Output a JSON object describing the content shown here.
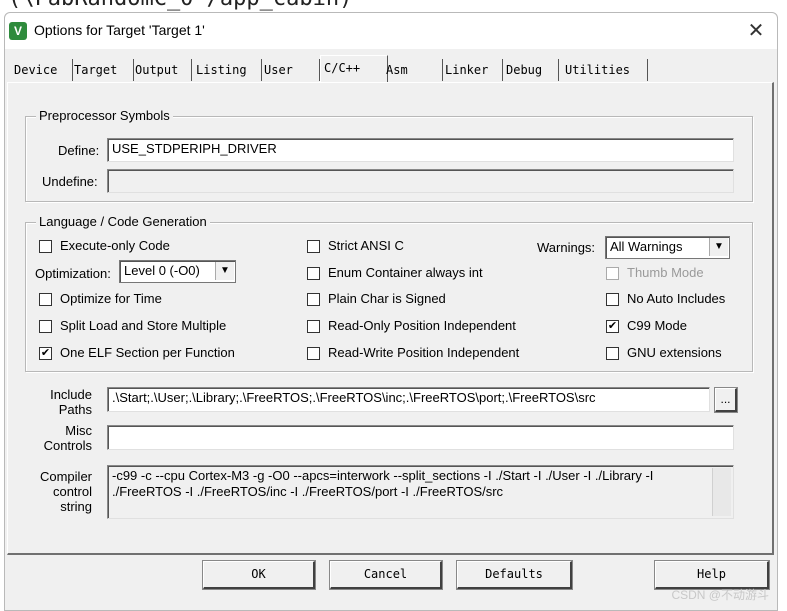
{
  "background_text": "(\\FabRandomC_0'/app_cabin)",
  "window": {
    "title": "Options for Target 'Target 1'",
    "close_glyph": "✕",
    "app_icon_glyph": "V"
  },
  "tabs": [
    {
      "label": "Device"
    },
    {
      "label": "Target"
    },
    {
      "label": "Output"
    },
    {
      "label": "Listing"
    },
    {
      "label": "User"
    },
    {
      "label": "C/C++"
    },
    {
      "label": "Asm"
    },
    {
      "label": "Linker"
    },
    {
      "label": "Debug"
    },
    {
      "label": "Utilities"
    }
  ],
  "active_tab": "C/C++",
  "preprocessor": {
    "group_label": "Preprocessor Symbols",
    "define_label": "Define:",
    "define_value": "USE_STDPERIPH_DRIVER",
    "undefine_label": "Undefine:",
    "undefine_value": ""
  },
  "language": {
    "group_label": "Language / Code Generation",
    "execute_only": {
      "label": "Execute-only Code",
      "checked": false
    },
    "optimization_label": "Optimization:",
    "optimization_value": "Level 0 (-O0)",
    "optimize_for_time": {
      "label": "Optimize for Time",
      "checked": false
    },
    "split_load_store": {
      "label": "Split Load and Store Multiple",
      "checked": false
    },
    "one_elf_section": {
      "label": "One ELF Section per Function",
      "checked": true
    },
    "strict_ansi_c": {
      "label": "Strict ANSI C",
      "checked": false
    },
    "enum_container": {
      "label": "Enum Container always int",
      "checked": false
    },
    "plain_char_signed": {
      "label": "Plain Char is Signed",
      "checked": false
    },
    "ro_pos_indep": {
      "label": "Read-Only Position Independent",
      "checked": false
    },
    "rw_pos_indep": {
      "label": "Read-Write Position Independent",
      "checked": false
    },
    "warnings_label": "Warnings:",
    "warnings_value": "All Warnings",
    "thumb_mode": {
      "label": "Thumb Mode",
      "checked": false,
      "disabled": true
    },
    "no_auto_includes": {
      "label": "No Auto Includes",
      "checked": false
    },
    "c99_mode": {
      "label": "C99 Mode",
      "checked": true
    },
    "gnu_extensions": {
      "label": "GNU extensions",
      "checked": false
    }
  },
  "paths": {
    "include_label_1": "Include",
    "include_label_2": "Paths",
    "include_value": ".\\Start;.\\User;.\\Library;.\\FreeRTOS;.\\FreeRTOS\\inc;.\\FreeRTOS\\port;.\\FreeRTOS\\src",
    "browse_label": "...",
    "misc_label_1": "Misc",
    "misc_label_2": "Controls",
    "misc_value": "",
    "compiler_label_1": "Compiler",
    "compiler_label_2": "control",
    "compiler_label_3": "string",
    "compiler_line_1": "-c99 -c --cpu Cortex-M3 -g -O0 --apcs=interwork --split_sections -I ./Start -I ./User -I ./Library -I",
    "compiler_line_2": "./FreeRTOS -I ./FreeRTOS/inc -I ./FreeRTOS/port -I ./FreeRTOS/src"
  },
  "buttons": {
    "ok": "OK",
    "cancel": "Cancel",
    "defaults": "Defaults",
    "help": "Help"
  },
  "watermark": "CSDN @不动游斗",
  "colors": {
    "dialog_bg": "#f0f0f0",
    "app_icon": "#2e8b3c"
  }
}
